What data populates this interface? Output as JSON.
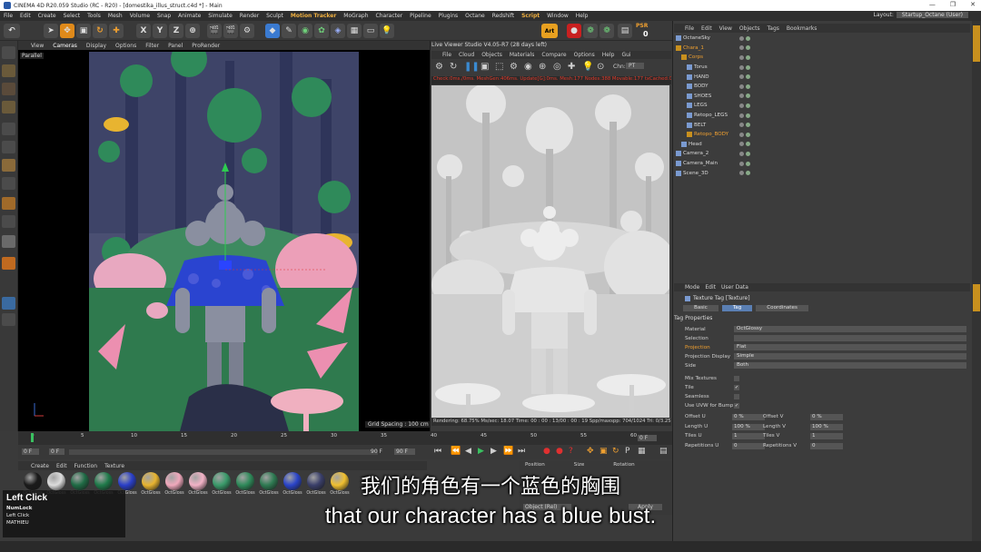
{
  "window": {
    "title": "CINEMA 4D R20.059 Studio (RC - R20) - [domestika_illus_struct.c4d *] - Main",
    "controls": [
      "—",
      "❐",
      "✕"
    ]
  },
  "menubar": {
    "items": [
      "File",
      "Edit",
      "Create",
      "Select",
      "Tools",
      "Mesh",
      "Volume",
      "Snap",
      "Animate",
      "Simulate",
      "Render",
      "Sculpt",
      "Motion Tracker",
      "MoGraph",
      "Character",
      "Pipeline",
      "Plugins",
      "Octane",
      "Redshift",
      "Script",
      "Window",
      "Help"
    ],
    "layout_label": "Layout:",
    "layout_value": "Startup_Octane (User)"
  },
  "toolbar": {
    "axis_buttons": [
      "X",
      "Y",
      "Z"
    ],
    "art_label": "Art",
    "psr_label": "PSR",
    "psr_value": "0"
  },
  "viewport": {
    "menu": [
      "View",
      "Cameras",
      "Display",
      "Options",
      "Filter",
      "Panel",
      "ProRender"
    ],
    "active_menu": "Cameras",
    "label": "Parallel",
    "grid_spacing": "Grid Spacing : 100 cm"
  },
  "live_viewer": {
    "title": "Live Viewer Studio V4.05-R7 (28 days left)",
    "menu": [
      "File",
      "Cloud",
      "Objects",
      "Materials",
      "Compare",
      "Options",
      "Help",
      "Gui"
    ],
    "channel_label": "Chn:",
    "channel_value": "PT",
    "stats": "Check:0ms./0ms. MeshGen:406ms. Update[G]:0ms. Mesh:177 Nodes:388 Movable:177 txCached:0",
    "bottom": "Rendering: 68.75%   Ms/sec: 18.07   Time: 00 : 00 : 13/00 : 00 : 19   Spp/maxspp: 704/1024   Tri: 0/3.25m"
  },
  "object_manager": {
    "menu": [
      "File",
      "Edit",
      "View",
      "Objects",
      "Tags",
      "Bookmarks"
    ],
    "objects": [
      {
        "name": "OctaneSky",
        "indent": 0,
        "color": "white"
      },
      {
        "name": "Chara_1",
        "indent": 0,
        "color": "orange"
      },
      {
        "name": "Corps",
        "indent": 1,
        "color": "orange"
      },
      {
        "name": "Torus",
        "indent": 2,
        "color": "white"
      },
      {
        "name": "HAND",
        "indent": 2,
        "color": "white"
      },
      {
        "name": "BODY",
        "indent": 2,
        "color": "white"
      },
      {
        "name": "SHOES",
        "indent": 2,
        "color": "white"
      },
      {
        "name": "LEGS",
        "indent": 2,
        "color": "white"
      },
      {
        "name": "Retopo_LEGS",
        "indent": 2,
        "color": "white"
      },
      {
        "name": "BELT",
        "indent": 2,
        "color": "white"
      },
      {
        "name": "Retopo_BODY",
        "indent": 2,
        "color": "orange"
      },
      {
        "name": "Head",
        "indent": 1,
        "color": "white"
      },
      {
        "name": "Camera_2",
        "indent": 0,
        "color": "white"
      },
      {
        "name": "Camera_Main",
        "indent": 0,
        "color": "white"
      },
      {
        "name": "Scene_3D",
        "indent": 0,
        "color": "white"
      }
    ]
  },
  "attributes": {
    "menu": [
      "Mode",
      "Edit",
      "User Data"
    ],
    "title": "Texture Tag [Texture]",
    "tabs": [
      "Basic",
      "Tag",
      "Coordinates"
    ],
    "active_tab": "Tag",
    "section": "Tag Properties",
    "rows": [
      {
        "label": "Material",
        "value": "OctGlossy"
      },
      {
        "label": "Selection",
        "value": ""
      },
      {
        "label": "Projection",
        "value": "Flat",
        "orange": true
      },
      {
        "label": "Projection Display",
        "value": "Simple"
      },
      {
        "label": "Side",
        "value": "Both"
      }
    ],
    "checks": [
      {
        "label": "Mix Textures",
        "value": ""
      },
      {
        "label": "Tile",
        "value": "✓"
      },
      {
        "label": "Seamless",
        "value": ""
      },
      {
        "label": "Use UVW for Bump",
        "value": "✓"
      }
    ],
    "numeric_left": [
      {
        "label": "Offset U",
        "value": "0 %"
      },
      {
        "label": "Length U",
        "value": "100 %"
      },
      {
        "label": "Tiles U",
        "value": "1"
      },
      {
        "label": "Repetitions U",
        "value": "0"
      }
    ],
    "numeric_right": [
      {
        "label": "Offset V",
        "value": "0 %"
      },
      {
        "label": "Length V",
        "value": "100 %"
      },
      {
        "label": "Tiles V",
        "value": "1"
      },
      {
        "label": "Repetitions V",
        "value": "0"
      }
    ]
  },
  "timeline": {
    "ticks": [
      "0",
      "5",
      "10",
      "15",
      "20",
      "25",
      "30",
      "35",
      "40",
      "45",
      "50",
      "55",
      "60"
    ],
    "current_frame": "0 F",
    "start": "0 F",
    "end": "90 F",
    "end2": "90 F",
    "frame_box": "0 F"
  },
  "material_manager": {
    "menu": [
      "Create",
      "Edit",
      "Function",
      "Texture"
    ],
    "materials": [
      {
        "label": "OctGloss",
        "color": "#1a1a1a"
      },
      {
        "label": "OctGloss",
        "color": "#dcdcdc"
      },
      {
        "label": "OctGloss",
        "color": "#1f6b45"
      },
      {
        "label": "OctGloss",
        "color": "#1f7a4a"
      },
      {
        "label": "OctGloss",
        "color": "#2a3fc8"
      },
      {
        "label": "OctGloss",
        "color": "#e8b430"
      },
      {
        "label": "OctGloss",
        "color": "#f0a8bc"
      },
      {
        "label": "OctGloss",
        "color": "#f2b2c6"
      },
      {
        "label": "OctGloss",
        "color": "#3a9a6a"
      },
      {
        "label": "OctGloss",
        "color": "#2f8a5a"
      },
      {
        "label": "OctGloss",
        "color": "#2e7a52"
      },
      {
        "label": "OctGloss",
        "color": "#2a44c8"
      },
      {
        "label": "OctGloss",
        "color": "#3a3f6a"
      },
      {
        "label": "OctGloss",
        "color": "#f0c030"
      }
    ]
  },
  "coordinates": {
    "headers": [
      "Position",
      "Size",
      "Rotation"
    ],
    "object_dropdown": "Object (Rel)",
    "apply_label": "Apply"
  },
  "overlay": {
    "title": "Left Click",
    "lines": [
      "NumLock",
      "Left Click",
      "MATHIEU"
    ]
  },
  "subtitles": {
    "chinese": "我们的角色有一个蓝色的胸围",
    "english": "that our character has a blue bust."
  }
}
